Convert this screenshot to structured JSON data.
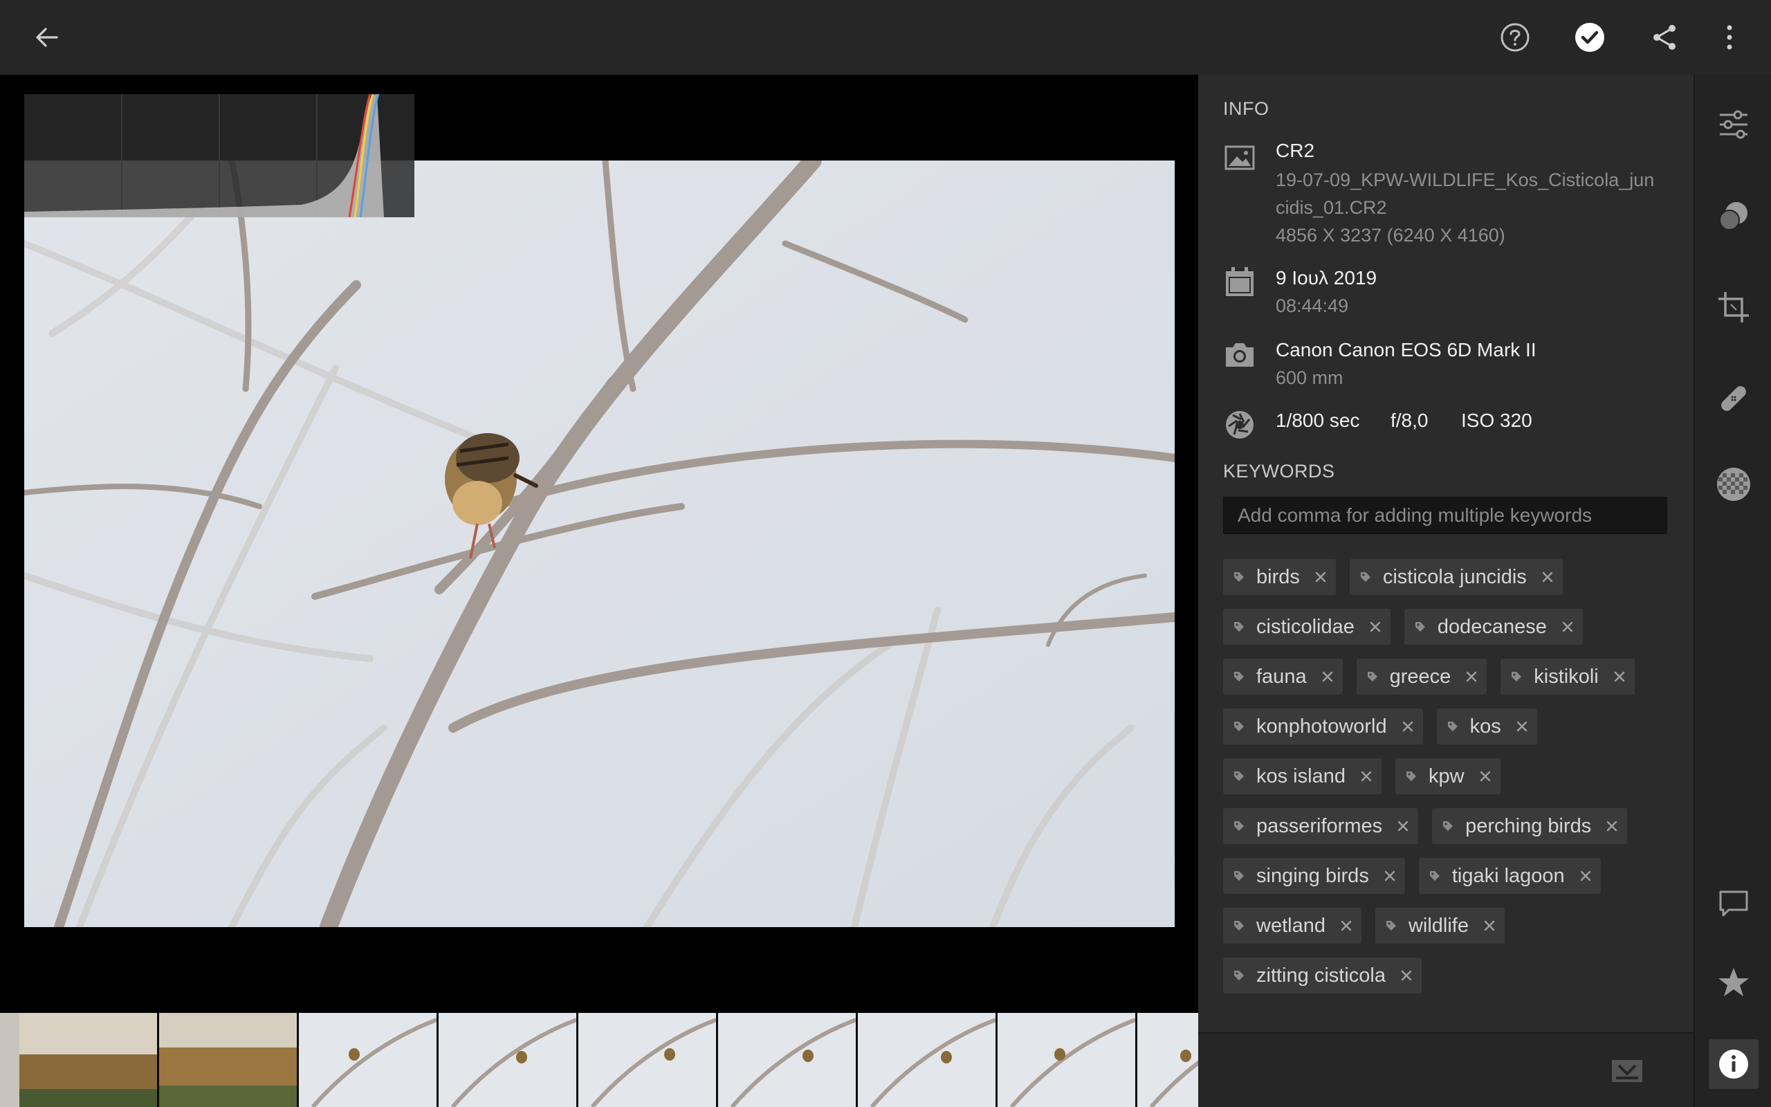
{
  "topbar": {
    "back_icon": "arrow-left-icon",
    "help_icon": "help-circle-icon",
    "check_icon": "check-circle-icon",
    "share_icon": "share-icon",
    "more_icon": "more-vertical-icon"
  },
  "info": {
    "section_title": "INFO",
    "file": {
      "format": "CR2",
      "filename_line1": "19-07-09_KPW-WILDLIFE_Kos_Cisticola_jun",
      "filename_line2": "cidis_01.CR2",
      "dimensions": "4856 X 3237 (6240 X 4160)"
    },
    "date": {
      "date": "9 Ιουλ 2019",
      "time": "08:44:49"
    },
    "camera": {
      "model": "Canon Canon EOS 6D Mark II",
      "lens": "600 mm"
    },
    "exposure": {
      "shutter": "1/800 sec",
      "aperture": "f/8,0",
      "iso": "ISO 320"
    }
  },
  "keywords": {
    "section_title": "KEYWORDS",
    "placeholder": "Add comma for adding multiple keywords",
    "rows": [
      [
        "birds",
        "cisticola juncidis"
      ],
      [
        "cisticolidae",
        "dodecanese"
      ],
      [
        "fauna",
        "greece",
        "kistikoli"
      ],
      [
        "konphotoworld",
        "kos"
      ],
      [
        "kos island",
        "kpw"
      ],
      [
        "passeriformes",
        "perching birds"
      ],
      [
        "singing birds",
        "tigaki lagoon"
      ],
      [
        "wetland",
        "wildlife"
      ],
      [
        "zitting cisticola"
      ]
    ]
  },
  "colors": {
    "accent": "#ffffff",
    "panel_bg": "#2b2b2b",
    "tag_bg": "#3a3a3a",
    "sky": "#dde2e8"
  }
}
